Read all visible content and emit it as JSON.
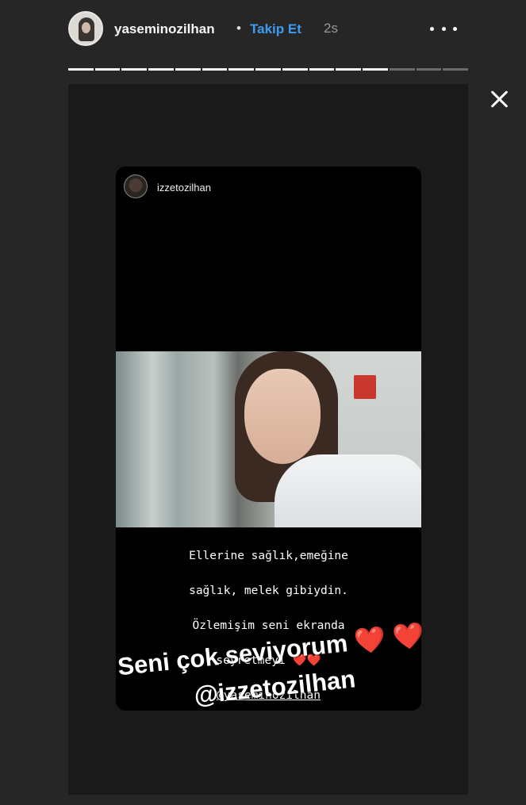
{
  "header": {
    "username": "yaseminozilhan",
    "separator": "•",
    "follow_label": "Takip Et",
    "time": "2s"
  },
  "progress": {
    "segments": 15,
    "completed": 12
  },
  "story": {
    "repost": {
      "username": "izzetozilhan",
      "caption_lines": [
        "Ellerine sağlık,emeğine",
        "sağlık, melek gibiydin.",
        "Özlemişim seni ekranda",
        "seyretmeyi"
      ],
      "caption_hearts": "❤️❤️",
      "caption_mention": "@yaseminozilhan"
    },
    "overlay": {
      "line1": "Seni çok seviyorum",
      "hearts": "❤️ ❤️",
      "line2": "@izzetozilhan"
    }
  },
  "icons": {
    "more": "more-horizontal-icon",
    "close": "close-icon"
  },
  "colors": {
    "background": "#262626",
    "follow": "#3d9cf0",
    "heart": "#e6312f"
  }
}
